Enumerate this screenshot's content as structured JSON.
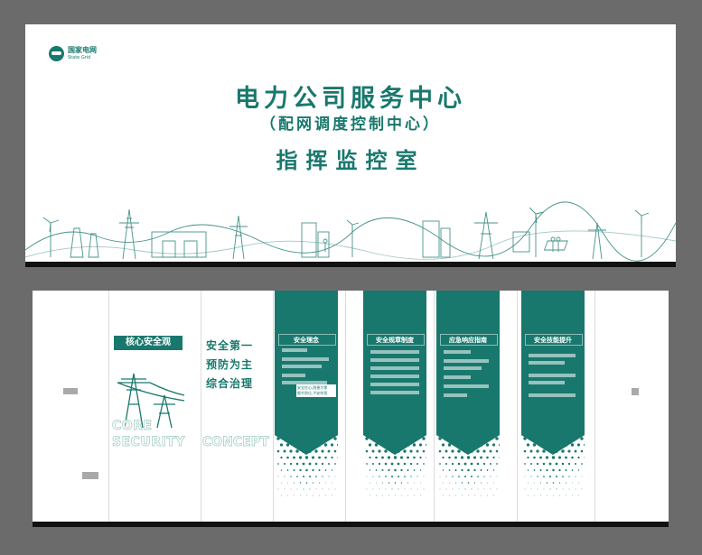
{
  "banner": {
    "logo_cn": "国家电网",
    "logo_en": "State Grid",
    "title": "电力公司服务中心",
    "subtitle": "（配网调度控制中心）",
    "room": "指挥监控室"
  },
  "wall": {
    "core_label": "核心安全观",
    "core_en_1": "CORE",
    "core_en_2": "SECURITY",
    "slogans": [
      "安全第一",
      "预防为主",
      "综合治理"
    ],
    "concept_en": "CONCEPT",
    "panels": [
      {
        "title": "安全理念",
        "note_1": "安全在心,隐患为零",
        "note_2": "细节到位,平安你我"
      },
      {
        "title": "安全规章制度"
      },
      {
        "title": "应急响应指南"
      },
      {
        "title": "安全技能提升"
      }
    ]
  },
  "colors": {
    "brand": "#19786d",
    "background": "#6b6b6b",
    "wall": "#ffffff"
  },
  "icons": [
    "logo-icon",
    "transmission-tower-icon"
  ]
}
